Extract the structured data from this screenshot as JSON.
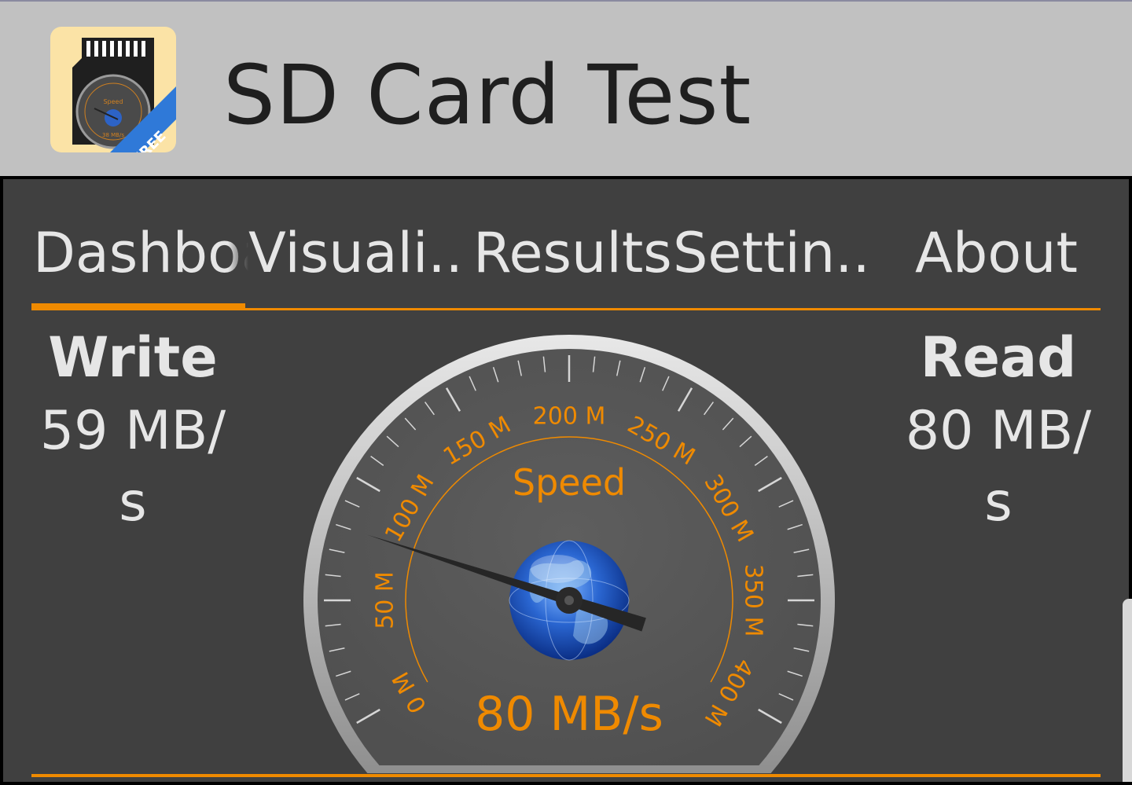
{
  "app": {
    "title": "SD Card Test",
    "icon": {
      "name": "sd-card-speed-icon",
      "speed_label": "Speed",
      "value_label": "38 MB/s",
      "badge": "FREE"
    }
  },
  "tabs": [
    {
      "label": "Dashboard",
      "active": true
    },
    {
      "label": "Visuali..",
      "active": false
    },
    {
      "label": "Results",
      "active": false
    },
    {
      "label": "Settin..",
      "active": false
    },
    {
      "label": "About",
      "active": false
    }
  ],
  "write": {
    "label": "Write",
    "value_line1": "59 MB/",
    "value_line2": "s"
  },
  "read": {
    "label": "Read",
    "value_line1": "80 MB/",
    "value_line2": "s"
  },
  "gauge": {
    "label": "Speed",
    "value_text": "80 MB/s",
    "scale_labels": [
      "0 M",
      "50 M",
      "100 M",
      "150 M",
      "200 M",
      "250 M",
      "300 M",
      "350 M",
      "400 M"
    ],
    "needle_value_mb": 80,
    "center_icon": "globe-icon"
  },
  "colors": {
    "accent": "#ef8a00",
    "appbar": "#c1c1c1",
    "panel": "#404040",
    "text": "#e6e6e6"
  }
}
